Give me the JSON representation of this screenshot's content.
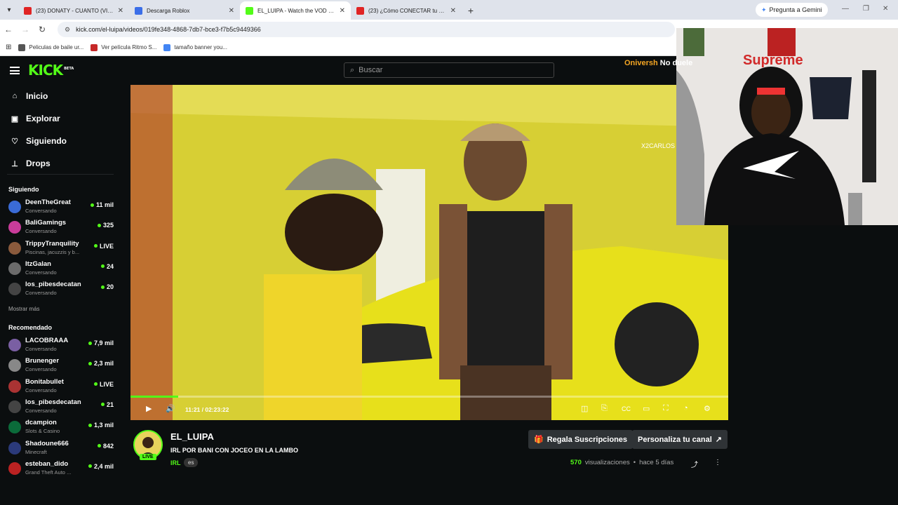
{
  "browser": {
    "tabs": [
      {
        "title": "(23) DONATY - CUANTO (VIDEO",
        "color": "#e02424",
        "active": false
      },
      {
        "title": "Descarga Roblox",
        "color": "#3b6ee8",
        "active": false
      },
      {
        "title": "EL_LUIPA - Watch the VOD on K",
        "color": "#53fc18",
        "active": true
      },
      {
        "title": "(23) ¿Cómo CONECTAR tu CÁMA",
        "color": "#e02424",
        "active": false
      }
    ],
    "gemini_label": "Pregunta a Gemini",
    "url": "kick.com/el-luipa/videos/019fe348-4868-7db7-bce3-f7b5c9449366",
    "bookmarks": [
      {
        "label": "Peliculas de baile ur...",
        "color": "#555"
      },
      {
        "label": "Ver película Ritmo S...",
        "color": "#c62828"
      },
      {
        "label": "tamaño banner you...",
        "color": "#4285f4"
      }
    ]
  },
  "kick": {
    "logo": "KICK",
    "logo_sup": "BETA",
    "search_placeholder": "Buscar",
    "nav": [
      {
        "label": "Inicio",
        "icon": "home-icon"
      },
      {
        "label": "Explorar",
        "icon": "explore-icon"
      },
      {
        "label": "Siguiendo",
        "icon": "heart-icon"
      },
      {
        "label": "Drops",
        "icon": "drops-icon"
      }
    ],
    "following_header": "Siguiendo",
    "following": [
      {
        "name": "DeenTheGreat",
        "category": "Conversando",
        "viewers": "11 mil",
        "color": "#3a6bd6"
      },
      {
        "name": "BaliGamings",
        "category": "Conversando",
        "viewers": "325",
        "color": "#c93c9a"
      },
      {
        "name": "TrippyTranquility",
        "category": "Piscinas, jacuzzis y b...",
        "viewers": "LIVE",
        "color": "#8a5a3c"
      },
      {
        "name": "ItzGalan",
        "category": "Conversando",
        "viewers": "24",
        "color": "#6b6b6b"
      },
      {
        "name": "los_pibesdecatan",
        "category": "Conversando",
        "viewers": "20",
        "color": "#444"
      }
    ],
    "show_more": "Mostrar más",
    "recommended_header": "Recomendado",
    "recommended": [
      {
        "name": "LACOBRAAA",
        "category": "Conversando",
        "viewers": "7,9 mil",
        "color": "#7a5fa3"
      },
      {
        "name": "Brunenger",
        "category": "Conversando",
        "viewers": "2,3 mil",
        "color": "#888"
      },
      {
        "name": "Bonitabullet",
        "category": "Conversando",
        "viewers": "LIVE",
        "color": "#a33"
      },
      {
        "name": "los_pibesdecatan",
        "category": "Conversando",
        "viewers": "21",
        "color": "#444"
      },
      {
        "name": "dcampion",
        "category": "Slots & Casino",
        "viewers": "1,3 mil",
        "color": "#0b6b3a"
      },
      {
        "name": "Shadoune666",
        "category": "Minecraft",
        "viewers": "842",
        "color": "#2b3a7a"
      },
      {
        "name": "esteban_dido",
        "category": "Grand Theft Auto ...",
        "viewers": "2,4 mil",
        "color": "#b22"
      }
    ],
    "overlay_user": "Oniversh",
    "overlay_user2": "No duele",
    "video_watermark": "X2CARLOS",
    "cam_text": "Supreme",
    "player": {
      "time": "11:21 / 02:23:22",
      "progress": 0.08
    },
    "channel": {
      "name": "EL_LUIPA",
      "title": "IRL POR BANI CON JOCEO EN LA LAMBO",
      "category": "IRL",
      "language": "es",
      "live": "LIVE",
      "views_count": "570",
      "views_label": "visualizaciones",
      "ago": "hace 5 días"
    },
    "buttons": {
      "gift": "Regala Suscripciones",
      "customize": "Personaliza tu canal"
    }
  }
}
